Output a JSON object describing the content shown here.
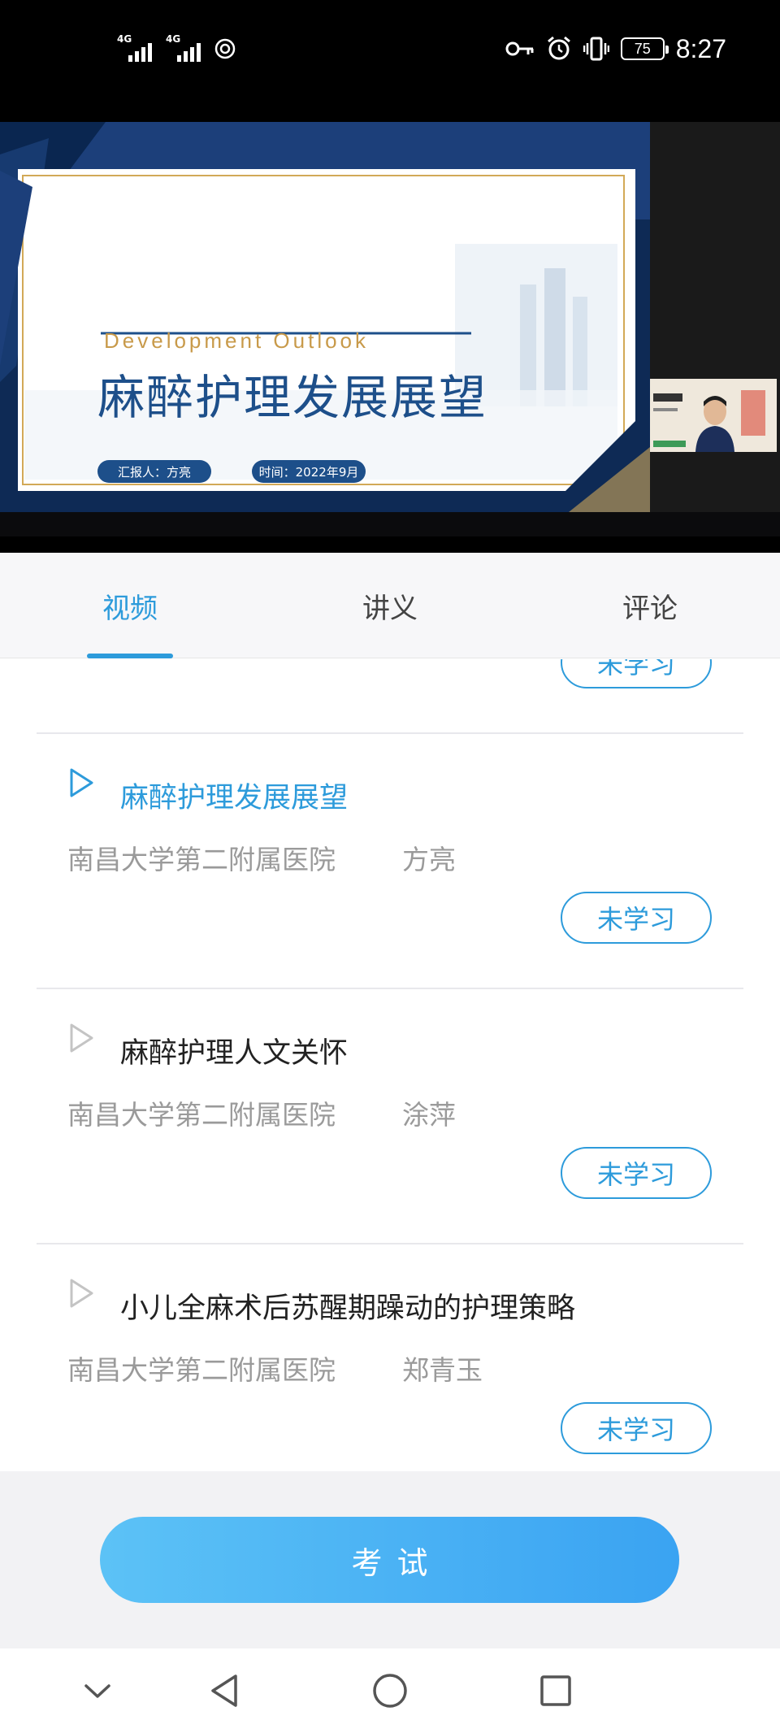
{
  "status_bar": {
    "network_1": "4G",
    "network_2": "4G",
    "battery": "75",
    "time": "8:27",
    "icons": [
      "signal-icon",
      "signal-icon",
      "hotspot-icon",
      "key-icon",
      "alarm-icon",
      "vibrate-icon",
      "battery-icon"
    ]
  },
  "video": {
    "slide_title_en": "Development  Outlook",
    "slide_title_cn": "麻醉护理发展展望",
    "slide_reporter": "汇报人：方亮",
    "slide_time": "时间：2022年9月"
  },
  "tabs": [
    {
      "label": "视频",
      "active": true
    },
    {
      "label": "讲义",
      "active": false
    },
    {
      "label": "评论",
      "active": false
    }
  ],
  "lessons": [
    {
      "title": "",
      "org": "",
      "author": "",
      "status": "未学习",
      "active": false
    },
    {
      "title": "麻醉护理发展展望",
      "org": "南昌大学第二附属医院",
      "author": "方亮",
      "status": "未学习",
      "active": true
    },
    {
      "title": "麻醉护理人文关怀",
      "org": "南昌大学第二附属医院",
      "author": "涂萍",
      "status": "未学习",
      "active": false
    },
    {
      "title": "小儿全麻术后苏醒期躁动的护理策略",
      "org": "南昌大学第二附属医院",
      "author": "郑青玉",
      "status": "未学习",
      "active": false
    }
  ],
  "exam_button": "考试",
  "navbar": {
    "icons": [
      "chevron-down-icon",
      "back-icon",
      "home-icon",
      "recents-icon"
    ]
  },
  "colors": {
    "accent": "#2d9bdb",
    "exam_start": "#5cc2f6",
    "exam_end": "#3aa3f2"
  }
}
